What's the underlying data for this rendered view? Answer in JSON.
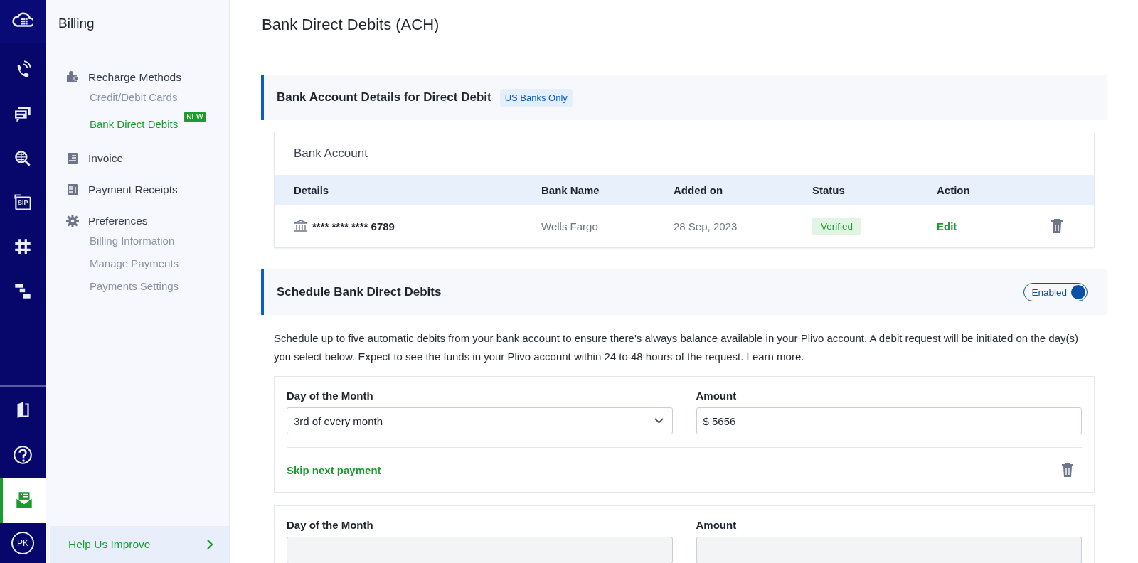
{
  "rail": {
    "top_items": [
      {
        "selected": false
      },
      {
        "selected": false
      },
      {
        "selected": false
      },
      {
        "selected": false
      },
      {
        "selected": false,
        "text": "SIP"
      },
      {
        "selected": false
      },
      {
        "selected": false
      }
    ],
    "bottom_items": [
      {
        "selected": false
      },
      {
        "selected": false
      },
      {
        "selected": true
      }
    ],
    "avatar": "PK"
  },
  "sidebar": {
    "title": "Billing",
    "groups": [
      {
        "label": "Recharge Methods",
        "selected": false,
        "children": [
          {
            "label": "Credit/Debit Cards",
            "selected": false
          },
          {
            "label": "Bank Direct Debits",
            "selected": true,
            "badge": "NEW"
          }
        ]
      },
      {
        "label": "Invoice",
        "selected": false
      },
      {
        "label": "Payment Receipts",
        "selected": false
      },
      {
        "label": "Preferences",
        "selected": false,
        "children": [
          {
            "label": "Billing Information",
            "selected": false
          },
          {
            "label": "Manage Payments",
            "selected": false
          },
          {
            "label": "Payments Settings",
            "selected": false
          }
        ]
      }
    ],
    "footer": {
      "label": "Help Us Improve"
    }
  },
  "page_title": "Bank Direct Debits (ACH)",
  "bank_section": {
    "title": "Bank Account Details for Direct Debit",
    "badge": "US Banks Only",
    "card_title": "Bank Account",
    "columns": [
      "Details",
      "Bank Name",
      "Added on",
      "Status",
      "Action"
    ],
    "rows": [
      {
        "details": "**** **** **** 6789",
        "bank_name": "Wells Fargo",
        "added_on": "28 Sep, 2023",
        "status": "Verified",
        "action": "Edit"
      }
    ]
  },
  "schedule_section": {
    "title": "Schedule Bank Direct Debits",
    "toggle": {
      "label": "Enabled",
      "on": true
    },
    "description": "Schedule up to five automatic debits from your bank account to ensure there's always balance available in your Plivo account. A debit request will be initiated on the day(s) you select below. Expect to see the funds in your Plivo account within 24 to 48 hours of the request. Learn more.",
    "schedules": [
      {
        "day_label": "Day of the Month",
        "day_value": "3rd of every month",
        "amount_label": "Amount",
        "amount_value": "$ 5656",
        "skip_link": "Skip next payment"
      },
      {
        "day_label": "Day of the Month",
        "amount_label": "Amount"
      }
    ]
  }
}
